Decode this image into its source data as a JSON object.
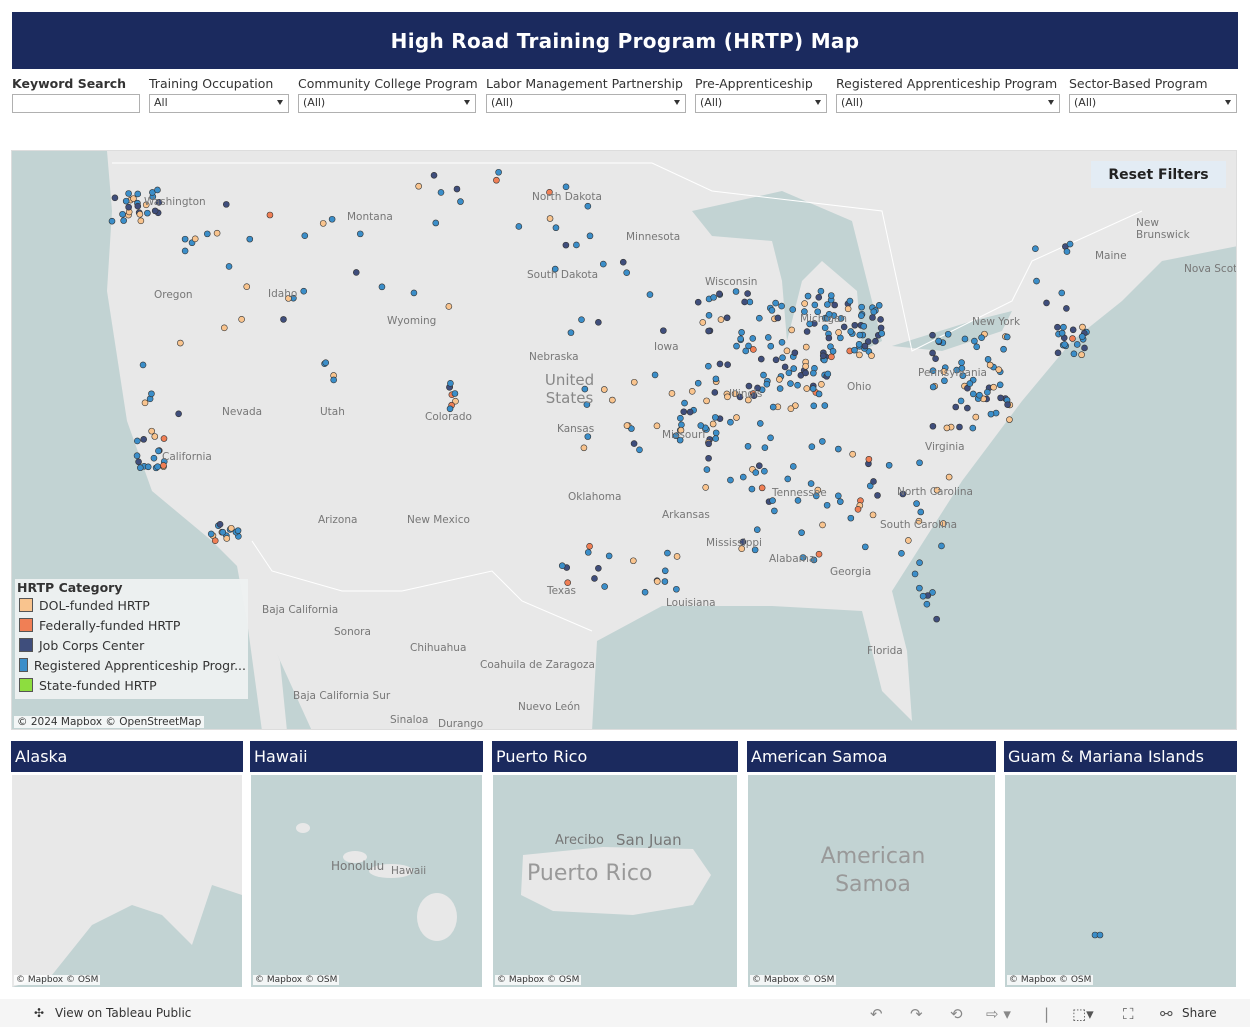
{
  "title": "High Road Training Program (HRTP) Map",
  "filters": [
    {
      "label": "Keyword Search",
      "value": "",
      "type": "text"
    },
    {
      "label": "Training Occupation",
      "value": "All"
    },
    {
      "label": "Community College Program",
      "value": "(All)"
    },
    {
      "label": "Labor Management Partnership",
      "value": "(All)"
    },
    {
      "label": "Pre-Apprenticeship",
      "value": "(All)"
    },
    {
      "label": "Registered Apprenticeship Program",
      "value": "(All)"
    },
    {
      "label": "Sector-Based Program",
      "value": "(All)"
    }
  ],
  "map": {
    "reset_label": "Reset Filters",
    "attribution": "© 2024 Mapbox  © OpenStreetMap",
    "country_label": "United States",
    "place_labels": [
      "Washington",
      "Montana",
      "North Dakota",
      "Minnesota",
      "Oregon",
      "Idaho",
      "South Dakota",
      "Wyoming",
      "Wisconsin",
      "Michigan",
      "New York",
      "Nebraska",
      "Iowa",
      "Nevada",
      "Utah",
      "Colorado",
      "Kansas",
      "Missouri",
      "Illinois",
      "Ohio",
      "Pennsylvania",
      "California",
      "Virginia",
      "Arizona",
      "New Mexico",
      "Oklahoma",
      "Arkansas",
      "Tennessee",
      "North Carolina",
      "South Carolina",
      "Mississippi",
      "Alabama",
      "Georgia",
      "Texas",
      "Louisiana",
      "Florida",
      "Maine",
      "New Brunswick",
      "Nova Scotia",
      "Baja California",
      "Sonora",
      "Chihuahua",
      "Coahuila de Zaragoza",
      "Baja California Sur",
      "Sinaloa",
      "Durango",
      "Nuevo León"
    ]
  },
  "legend": {
    "title": "HRTP Category",
    "items": [
      {
        "label": "DOL-funded HRTP",
        "color": "#f9c48e"
      },
      {
        "label": "Federally-funded HRTP",
        "color": "#f07f55"
      },
      {
        "label": "Job Corps Center",
        "color": "#3f4e7c"
      },
      {
        "label": "Registered Apprenticeship Progr...",
        "color": "#3b8ec9"
      },
      {
        "label": "State-funded HRTP",
        "color": "#8ddd3f"
      }
    ]
  },
  "insets": [
    {
      "title": "Alaska",
      "attribution": "© Mapbox  © OSM",
      "labels": []
    },
    {
      "title": "Hawaii",
      "attribution": "© Mapbox  © OSM",
      "labels": [
        "Honolulu",
        "Hawaii"
      ]
    },
    {
      "title": "Puerto Rico",
      "attribution": "© Mapbox  © OSM",
      "labels": [
        "Arecibo",
        "San Juan",
        "Puerto Rico"
      ]
    },
    {
      "title": "American Samoa",
      "attribution": "© Mapbox  © OSM",
      "labels": [
        "American Samoa"
      ]
    },
    {
      "title": "Guam & Mariana Islands",
      "attribution": "© Mapbox  © OSM",
      "labels": []
    }
  ],
  "footer": {
    "view_label": "View on Tableau Public",
    "share_label": "Share"
  },
  "colors": {
    "header": "#1b2a5e",
    "water": "#c2d3d3",
    "land": "#e8e8e8"
  }
}
